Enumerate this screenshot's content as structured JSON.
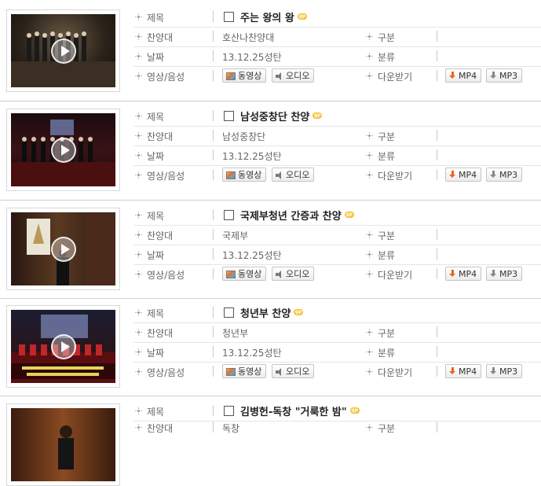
{
  "labels": {
    "title": "제목",
    "choir": "찬양대",
    "date": "날짜",
    "media": "영상/음성",
    "category": "구분",
    "classification": "분류",
    "download": "다운받기"
  },
  "buttons": {
    "video": "동영상",
    "audio": "오디오",
    "mp4": "MP4",
    "mp3": "MP3"
  },
  "badge": "gp",
  "entries": [
    {
      "title": "주는 왕의 왕",
      "choir": "호산나찬양대",
      "date": "13.12.25성탄",
      "category": "",
      "classification": ""
    },
    {
      "title": "남성중창단 찬양",
      "choir": "남성중창단",
      "date": "13.12.25성탄",
      "category": "",
      "classification": ""
    },
    {
      "title": "국제부청년 간증과 찬양",
      "choir": "국제부",
      "date": "13.12.25성탄",
      "category": "",
      "classification": ""
    },
    {
      "title": "청년부 찬양",
      "choir": "청년부",
      "date": "13.12.25성탄",
      "category": "",
      "classification": ""
    },
    {
      "title": "김병헌-독창 \"거룩한 밤\"",
      "choir": "독창",
      "date": "",
      "category": "",
      "classification": ""
    }
  ]
}
